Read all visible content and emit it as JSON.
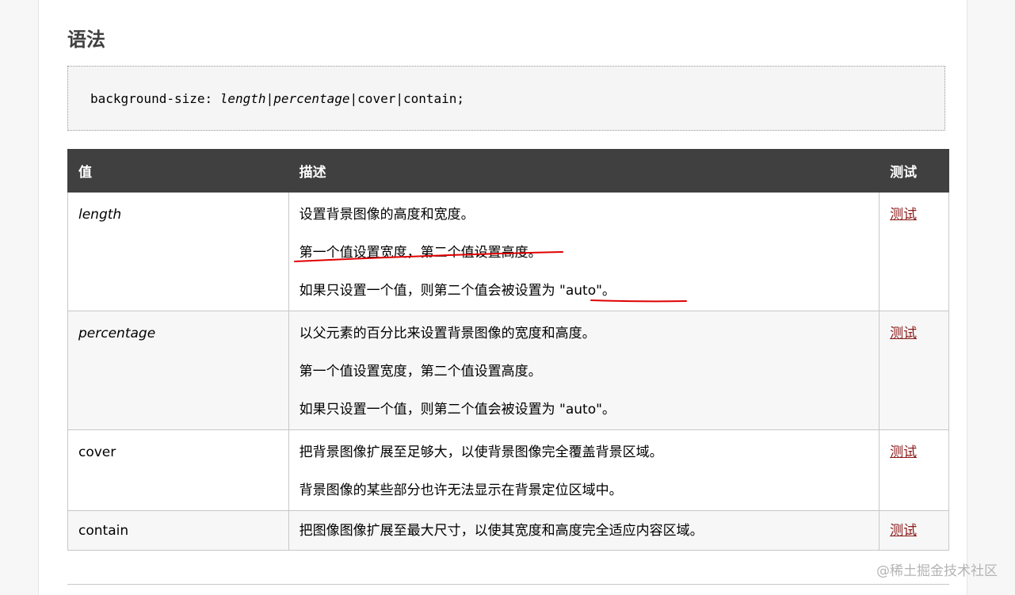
{
  "heading": "语法",
  "code": {
    "prefix": "background-size: ",
    "length": "length",
    "sep1": "|",
    "percentage": "percentage",
    "sep2": "|",
    "rest": "cover|contain;"
  },
  "table": {
    "headers": [
      "值",
      "描述",
      "测试"
    ],
    "rows": [
      {
        "value": "length",
        "lines": [
          "设置背景图像的高度和宽度。",
          "第一个值设置宽度，第二个值设置高度。",
          "如果只设置一个值，则第二个值会被设置为 \"auto\"。"
        ],
        "link": "测试"
      },
      {
        "value": "percentage",
        "lines": [
          "以父元素的百分比来设置背景图像的宽度和高度。",
          "第一个值设置宽度，第二个值设置高度。",
          "如果只设置一个值，则第二个值会被设置为 \"auto\"。"
        ],
        "link": "测试"
      },
      {
        "value": "cover",
        "lines": [
          "把背景图像扩展至足够大，以使背景图像完全覆盖背景区域。",
          "背景图像的某些部分也许无法显示在背景定位区域中。"
        ],
        "link": "测试"
      },
      {
        "value": "contain",
        "lines": [
          "把图像图像扩展至最大尺寸，以使其宽度和高度完全适应内容区域。"
        ],
        "link": "测试"
      }
    ]
  },
  "watermark": "@稀土掘金技术社区",
  "colors": {
    "header_bg": "#404040",
    "link": "#8b1b1b",
    "annotation": "#e00000"
  }
}
